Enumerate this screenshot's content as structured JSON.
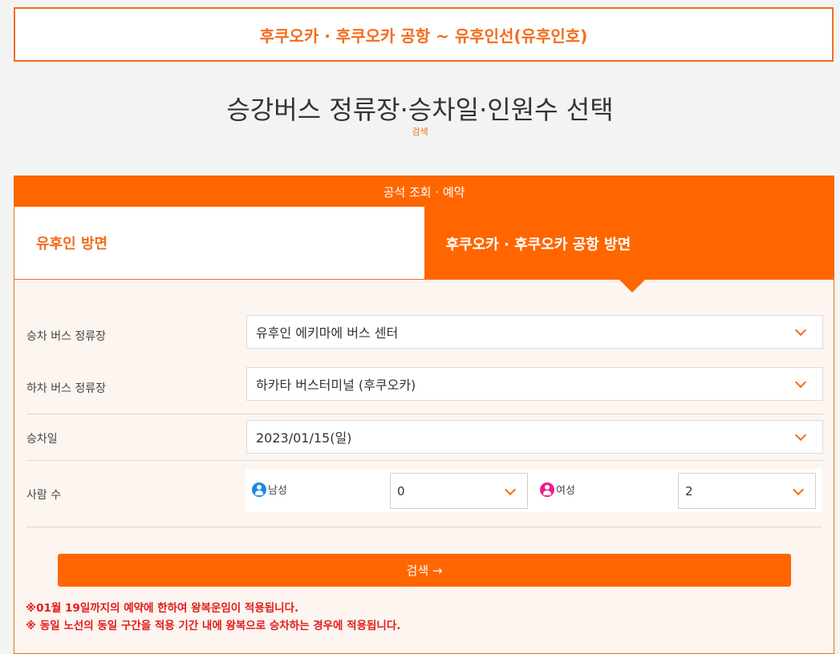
{
  "route_title": "후쿠오카 · 후쿠오카 공항 ~ 유후인선(유후인호)",
  "page_title": "승강버스 정류장·승차일·인원수 선택",
  "page_subtitle": "검색",
  "panel": {
    "header": "공석 조회 · 예약",
    "tabs": [
      {
        "label": "유후인 방면",
        "active": false
      },
      {
        "label": "후쿠오카 · 후쿠오카 공항 방면",
        "active": true
      }
    ]
  },
  "form": {
    "boarding_label": "승차 버스 정류장",
    "boarding_value": "유후인 에키마에 버스 센터",
    "alighting_label": "하차 버스 정류장",
    "alighting_value": "하카타 버스터미널 (후쿠오카)",
    "date_label": "승차일",
    "date_value": "2023/01/15(일)",
    "people_label": "사람 수",
    "male_label": "남성",
    "male_value": "0",
    "female_label": "여성",
    "female_value": "2"
  },
  "search_button": "검색 →",
  "notes": [
    "※01월 19일까지의 예약에 한하여 왕복운임이 적용됩니다.",
    "※ 동일 노선의 동일 구간을 적용 기간 내에 왕복으로 승차하는 경우에 적용됩니다."
  ],
  "colors": {
    "accent": "#ff6600",
    "accent_text": "#f36c1c",
    "male_icon": "#1e88e5",
    "female_icon": "#e91e8c",
    "note_text": "#e21b1b"
  }
}
